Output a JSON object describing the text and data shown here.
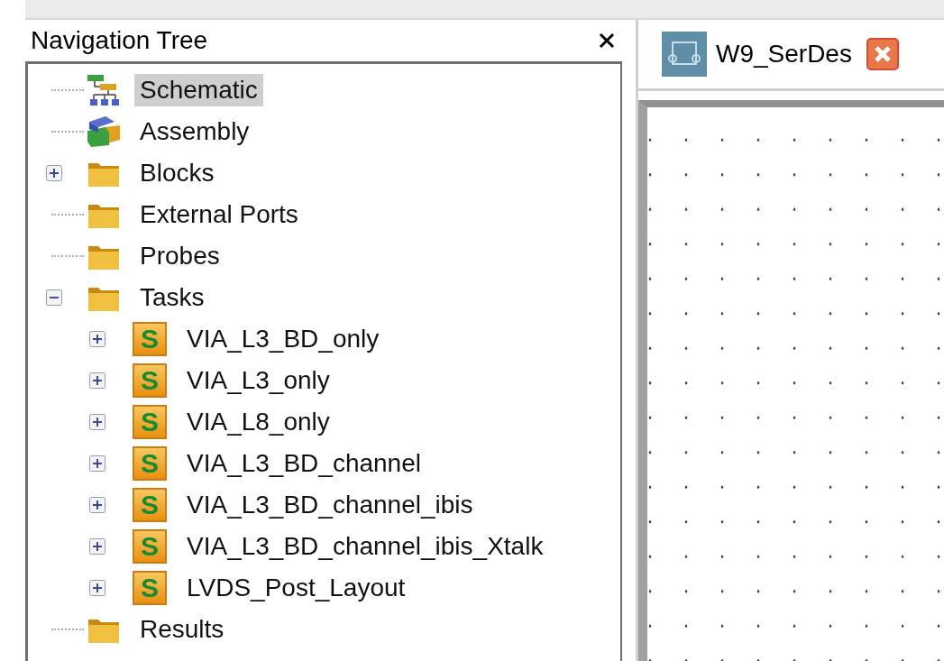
{
  "panel": {
    "title": "Navigation Tree"
  },
  "tree": [
    {
      "label": "Schematic",
      "kind": "schematic",
      "selected": true
    },
    {
      "label": "Assembly",
      "kind": "assembly",
      "selected": false
    },
    {
      "label": "Blocks",
      "kind": "folder",
      "selected": false,
      "expanded": false
    },
    {
      "label": "External Ports",
      "kind": "folder",
      "selected": false
    },
    {
      "label": "Probes",
      "kind": "folder",
      "selected": false
    },
    {
      "label": "Tasks",
      "kind": "folder",
      "selected": false,
      "expanded": true,
      "children": [
        {
          "label": "VIA_L3_BD_only",
          "kind": "task",
          "badge": "S",
          "selected": false,
          "expanded": false
        },
        {
          "label": "VIA_L3_only",
          "kind": "task",
          "badge": "S",
          "selected": false,
          "expanded": false
        },
        {
          "label": "VIA_L8_only",
          "kind": "task",
          "badge": "S",
          "selected": false,
          "expanded": false
        },
        {
          "label": "VIA_L3_BD_channel",
          "kind": "task",
          "badge": "S",
          "selected": false,
          "expanded": false
        },
        {
          "label": "VIA_L3_BD_channel_ibis",
          "kind": "task",
          "badge": "S",
          "selected": false,
          "expanded": false
        },
        {
          "label": "VIA_L3_BD_channel_ibis_Xtalk",
          "kind": "task",
          "badge": "S",
          "selected": false,
          "expanded": false
        },
        {
          "label": "LVDS_Post_Layout",
          "kind": "task",
          "badge": "S",
          "selected": false,
          "expanded": false
        }
      ]
    },
    {
      "label": "Results",
      "kind": "folder",
      "selected": false
    }
  ],
  "tabs": [
    {
      "label": "W9_SerDes",
      "selected": true
    }
  ]
}
